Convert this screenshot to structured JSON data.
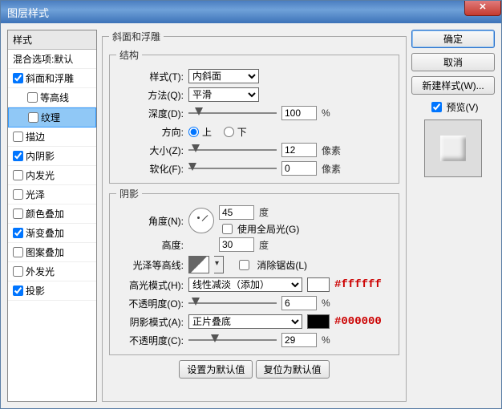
{
  "window": {
    "title": "图层样式"
  },
  "sidebar": {
    "header": "样式",
    "blending": "混合选项:默认",
    "items": [
      {
        "label": "斜面和浮雕",
        "checked": true
      },
      {
        "label": "等高线",
        "checked": false,
        "sub": true
      },
      {
        "label": "纹理",
        "checked": false,
        "sub": true,
        "selected": true
      },
      {
        "label": "描边",
        "checked": false
      },
      {
        "label": "内阴影",
        "checked": true
      },
      {
        "label": "内发光",
        "checked": false
      },
      {
        "label": "光泽",
        "checked": false
      },
      {
        "label": "颜色叠加",
        "checked": false
      },
      {
        "label": "渐变叠加",
        "checked": true
      },
      {
        "label": "图案叠加",
        "checked": false
      },
      {
        "label": "外发光",
        "checked": false
      },
      {
        "label": "投影",
        "checked": true
      }
    ]
  },
  "panel": {
    "main_legend": "斜面和浮雕",
    "struct_legend": "结构",
    "style_label": "样式(T):",
    "style_value": "内斜面",
    "tech_label": "方法(Q):",
    "tech_value": "平滑",
    "depth_label": "深度(D):",
    "depth_value": "100",
    "depth_unit": "%",
    "dir_label": "方向:",
    "dir_up": "上",
    "dir_down": "下",
    "size_label": "大小(Z):",
    "size_value": "12",
    "size_unit": "像素",
    "soften_label": "软化(F):",
    "soften_value": "0",
    "soften_unit": "像素",
    "shade_legend": "阴影",
    "angle_label": "角度(N):",
    "angle_value": "45",
    "angle_unit": "度",
    "global_label": "使用全局光(G)",
    "alt_label": "高度:",
    "alt_value": "30",
    "alt_unit": "度",
    "gloss_label": "光泽等高线:",
    "aa_label": "消除锯齿(L)",
    "hmode_label": "高光模式(H):",
    "hmode_value": "线性减淡（添加）",
    "hcolor_hex": "#ffffff",
    "hopac_label": "不透明度(O):",
    "hopac_value": "6",
    "hopac_unit": "%",
    "smode_label": "阴影模式(A):",
    "smode_value": "正片叠底",
    "scolor_hex": "#000000",
    "sopac_label": "不透明度(C):",
    "sopac_value": "29",
    "sopac_unit": "%",
    "btn_default": "设置为默认值",
    "btn_reset": "复位为默认值"
  },
  "right": {
    "ok": "确定",
    "cancel": "取消",
    "new_style": "新建样式(W)...",
    "preview": "预览(V)"
  }
}
